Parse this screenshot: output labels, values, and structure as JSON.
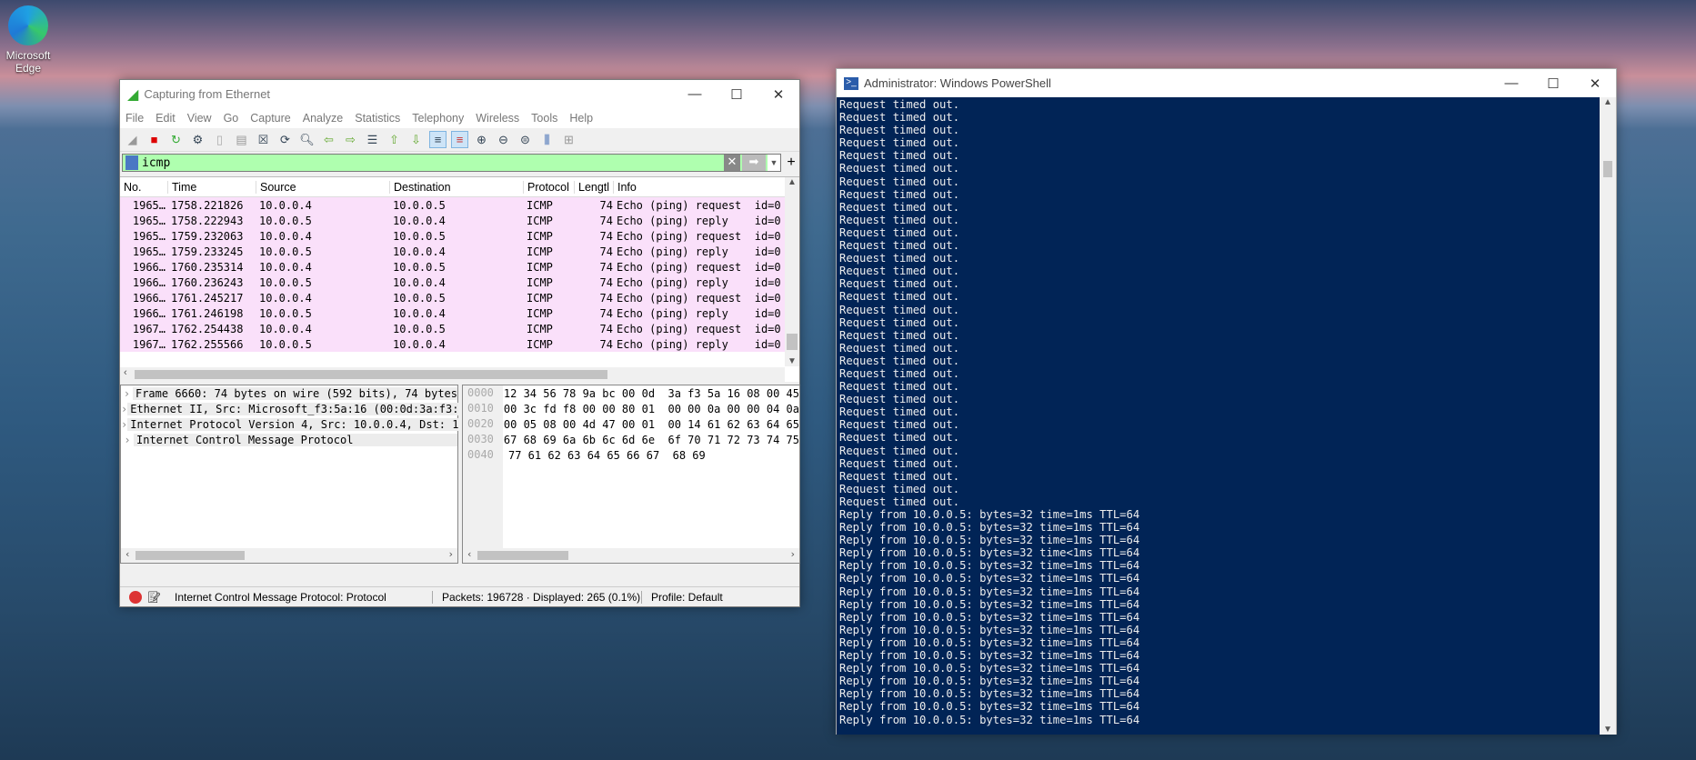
{
  "desktop": {
    "icon_label": "Microsoft Edge"
  },
  "wireshark": {
    "title": "Capturing from Ethernet",
    "menu": [
      "File",
      "Edit",
      "View",
      "Go",
      "Capture",
      "Analyze",
      "Statistics",
      "Telephony",
      "Wireless",
      "Tools",
      "Help"
    ],
    "filter": "icmp",
    "columns": [
      "No.",
      "Time",
      "Source",
      "Destination",
      "Protocol",
      "Lengtl",
      "Info"
    ],
    "rows": [
      [
        "1965…",
        "1758.221826",
        "10.0.0.4",
        "10.0.0.5",
        "ICMP",
        "74",
        "Echo (ping) request  id=0"
      ],
      [
        "1965…",
        "1758.222943",
        "10.0.0.5",
        "10.0.0.4",
        "ICMP",
        "74",
        "Echo (ping) reply    id=0"
      ],
      [
        "1965…",
        "1759.232063",
        "10.0.0.4",
        "10.0.0.5",
        "ICMP",
        "74",
        "Echo (ping) request  id=0"
      ],
      [
        "1965…",
        "1759.233245",
        "10.0.0.5",
        "10.0.0.4",
        "ICMP",
        "74",
        "Echo (ping) reply    id=0"
      ],
      [
        "1966…",
        "1760.235314",
        "10.0.0.4",
        "10.0.0.5",
        "ICMP",
        "74",
        "Echo (ping) request  id=0"
      ],
      [
        "1966…",
        "1760.236243",
        "10.0.0.5",
        "10.0.0.4",
        "ICMP",
        "74",
        "Echo (ping) reply    id=0"
      ],
      [
        "1966…",
        "1761.245217",
        "10.0.0.4",
        "10.0.0.5",
        "ICMP",
        "74",
        "Echo (ping) request  id=0"
      ],
      [
        "1966…",
        "1761.246198",
        "10.0.0.5",
        "10.0.0.4",
        "ICMP",
        "74",
        "Echo (ping) reply    id=0"
      ],
      [
        "1967…",
        "1762.254438",
        "10.0.0.4",
        "10.0.0.5",
        "ICMP",
        "74",
        "Echo (ping) request  id=0"
      ],
      [
        "1967…",
        "1762.255566",
        "10.0.0.5",
        "10.0.0.4",
        "ICMP",
        "74",
        "Echo (ping) reply    id=0"
      ]
    ],
    "details": [
      "Frame 6660: 74 bytes on wire (592 bits), 74 bytes",
      "Ethernet II, Src: Microsoft_f3:5a:16 (00:0d:3a:f3:",
      "Internet Protocol Version 4, Src: 10.0.0.4, Dst: 1",
      "Internet Control Message Protocol"
    ],
    "hex": [
      [
        "0000",
        "12 34 56 78 9a bc 00 0d  3a f3 5a 16 08 00 45"
      ],
      [
        "0010",
        "00 3c fd f8 00 00 80 01  00 00 0a 00 00 04 0a"
      ],
      [
        "0020",
        "00 05 08 00 4d 47 00 01  00 14 61 62 63 64 65"
      ],
      [
        "0030",
        "67 68 69 6a 6b 6c 6d 6e  6f 70 71 72 73 74 75"
      ],
      [
        "0040",
        "77 61 62 63 64 65 66 67  68 69"
      ]
    ],
    "status": {
      "field": "Internet Control Message Protocol: Protocol",
      "packets": "Packets: 196728 · Displayed: 265 (0.1%)",
      "profile": "Profile: Default"
    }
  },
  "powershell": {
    "title": "Administrator: Windows PowerShell",
    "timeout_line": "Request timed out.",
    "timeout_count": 32,
    "replies": [
      "Reply from 10.0.0.5: bytes=32 time=1ms TTL=64",
      "Reply from 10.0.0.5: bytes=32 time=1ms TTL=64",
      "Reply from 10.0.0.5: bytes=32 time=1ms TTL=64",
      "Reply from 10.0.0.5: bytes=32 time<1ms TTL=64",
      "Reply from 10.0.0.5: bytes=32 time=1ms TTL=64",
      "Reply from 10.0.0.5: bytes=32 time=1ms TTL=64",
      "Reply from 10.0.0.5: bytes=32 time=1ms TTL=64",
      "Reply from 10.0.0.5: bytes=32 time=1ms TTL=64",
      "Reply from 10.0.0.5: bytes=32 time=1ms TTL=64",
      "Reply from 10.0.0.5: bytes=32 time=1ms TTL=64",
      "Reply from 10.0.0.5: bytes=32 time=1ms TTL=64",
      "Reply from 10.0.0.5: bytes=32 time=1ms TTL=64",
      "Reply from 10.0.0.5: bytes=32 time=1ms TTL=64",
      "Reply from 10.0.0.5: bytes=32 time=1ms TTL=64",
      "Reply from 10.0.0.5: bytes=32 time=1ms TTL=64",
      "Reply from 10.0.0.5: bytes=32 time=1ms TTL=64",
      "Reply from 10.0.0.5: bytes=32 time=1ms TTL=64"
    ]
  }
}
